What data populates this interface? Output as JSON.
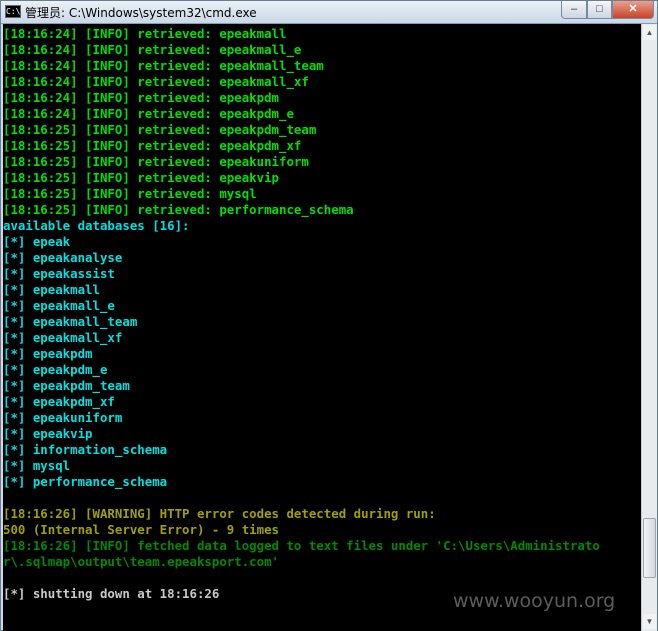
{
  "window": {
    "title": "管理员: C:\\Windows\\system32\\cmd.exe",
    "icon_text": "C:\\",
    "controls": {
      "minimize": "–",
      "maximize": "□",
      "close": "✕"
    }
  },
  "console": {
    "lines": [
      {
        "text": "[18:16:24] [INFO] retrieved: epeakmall",
        "color": "green"
      },
      {
        "text": "[18:16:24] [INFO] retrieved: epeakmall_e",
        "color": "green"
      },
      {
        "text": "[18:16:24] [INFO] retrieved: epeakmall_team",
        "color": "green"
      },
      {
        "text": "[18:16:24] [INFO] retrieved: epeakmall_xf",
        "color": "green"
      },
      {
        "text": "[18:16:24] [INFO] retrieved: epeakpdm",
        "color": "green"
      },
      {
        "text": "[18:16:24] [INFO] retrieved: epeakpdm_e",
        "color": "green"
      },
      {
        "text": "[18:16:25] [INFO] retrieved: epeakpdm_team",
        "color": "green"
      },
      {
        "text": "[18:16:25] [INFO] retrieved: epeakpdm_xf",
        "color": "green"
      },
      {
        "text": "[18:16:25] [INFO] retrieved: epeakuniform",
        "color": "green"
      },
      {
        "text": "[18:16:25] [INFO] retrieved: epeakvip",
        "color": "green"
      },
      {
        "text": "[18:16:25] [INFO] retrieved: mysql",
        "color": "green"
      },
      {
        "text": "[18:16:25] [INFO] retrieved: performance_schema",
        "color": "green"
      },
      {
        "text": "available databases [16]:",
        "color": "cyan"
      },
      {
        "text": "[*] epeak",
        "color": "cyan"
      },
      {
        "text": "[*] epeakanalyse",
        "color": "cyan"
      },
      {
        "text": "[*] epeakassist",
        "color": "cyan"
      },
      {
        "text": "[*] epeakmall",
        "color": "cyan"
      },
      {
        "text": "[*] epeakmall_e",
        "color": "cyan"
      },
      {
        "text": "[*] epeakmall_team",
        "color": "cyan"
      },
      {
        "text": "[*] epeakmall_xf",
        "color": "cyan"
      },
      {
        "text": "[*] epeakpdm",
        "color": "cyan"
      },
      {
        "text": "[*] epeakpdm_e",
        "color": "cyan"
      },
      {
        "text": "[*] epeakpdm_team",
        "color": "cyan"
      },
      {
        "text": "[*] epeakpdm_xf",
        "color": "cyan"
      },
      {
        "text": "[*] epeakuniform",
        "color": "cyan"
      },
      {
        "text": "[*] epeakvip",
        "color": "cyan"
      },
      {
        "text": "[*] information_schema",
        "color": "cyan"
      },
      {
        "text": "[*] mysql",
        "color": "cyan"
      },
      {
        "text": "[*] performance_schema",
        "color": "cyan"
      },
      {
        "text": "",
        "color": "white"
      },
      {
        "text": "[18:16:26] [WARNING] HTTP error codes detected during run:",
        "color": "yellow"
      },
      {
        "text": "500 (Internal Server Error) - 9 times",
        "color": "yellow"
      },
      {
        "text": "[18:16:26] [INFO] fetched data logged to text files under 'C:\\Users\\Administrato",
        "color": "dgreen"
      },
      {
        "text": "r\\.sqlmap\\output\\team.epeaksport.com'",
        "color": "dgreen"
      },
      {
        "text": "",
        "color": "white"
      },
      {
        "text": "[*] shutting down at 18:16:26",
        "color": "white"
      }
    ]
  },
  "scrollbar": {
    "up_arrow": "▲",
    "down_arrow": "▼"
  },
  "watermark": "www.wooyun.org"
}
